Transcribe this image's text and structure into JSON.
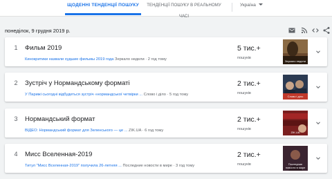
{
  "header": {
    "tab_daily": "ЩОДЕННІ ТЕНДЕНЦІЇ ПОШУКУ",
    "tab_realtime": "ТЕНДЕНЦІЇ ПОШУКУ В РЕАЛЬНОМУ ЧАСІ",
    "country": "Україна"
  },
  "date_label": "понеділок, 9 грудня 2019 р.",
  "toolbar": {
    "icons": [
      "email-icon",
      "rss-icon",
      "embed-icon",
      "share-icon"
    ]
  },
  "trends": [
    {
      "rank": "1",
      "title": "Фильм 2019",
      "article_link": "Кинокритики назвали худшие фильмы 2019 года",
      "article_source": "Зеркало недели · 2 год тому",
      "count": "5 тис.+",
      "count_label": "пошуків",
      "thumb_caption": "Зеркало недели",
      "thumb_color": "#6b4a2e"
    },
    {
      "rank": "2",
      "title": "Зустріч у Нормандському форматі",
      "article_link": "У Парижі сьогодні відбудеться зустріч «нормандської четвірки ...",
      "article_source": "Слово і діло · 5 год тому",
      "count": "2 тис.+",
      "count_label": "пошуків",
      "thumb_caption": "Слово і діло",
      "thumb_color": "#2b3a52"
    },
    {
      "rank": "3",
      "title": "Нормандський формат",
      "article_link": "ВІДЕО: Нормандський формат для Зеленського — це ...",
      "article_source": "ZIK.UA · 6 год тому",
      "count": "2 тис.+",
      "count_label": "пошуків",
      "thumb_caption": "ZIK.UA",
      "thumb_color": "#7a1f1f"
    },
    {
      "rank": "4",
      "title": "Мисс Вселенная-2019",
      "article_link": "Титул \"Мисс Вселенная-2019\" получила 26-летняя ...",
      "article_source": "Последние новости в мире · 3 год тому",
      "count": "2 тис.+",
      "count_label": "пошуків",
      "thumb_caption": "Последние новости в мире",
      "thumb_color": "#3a2430"
    }
  ]
}
